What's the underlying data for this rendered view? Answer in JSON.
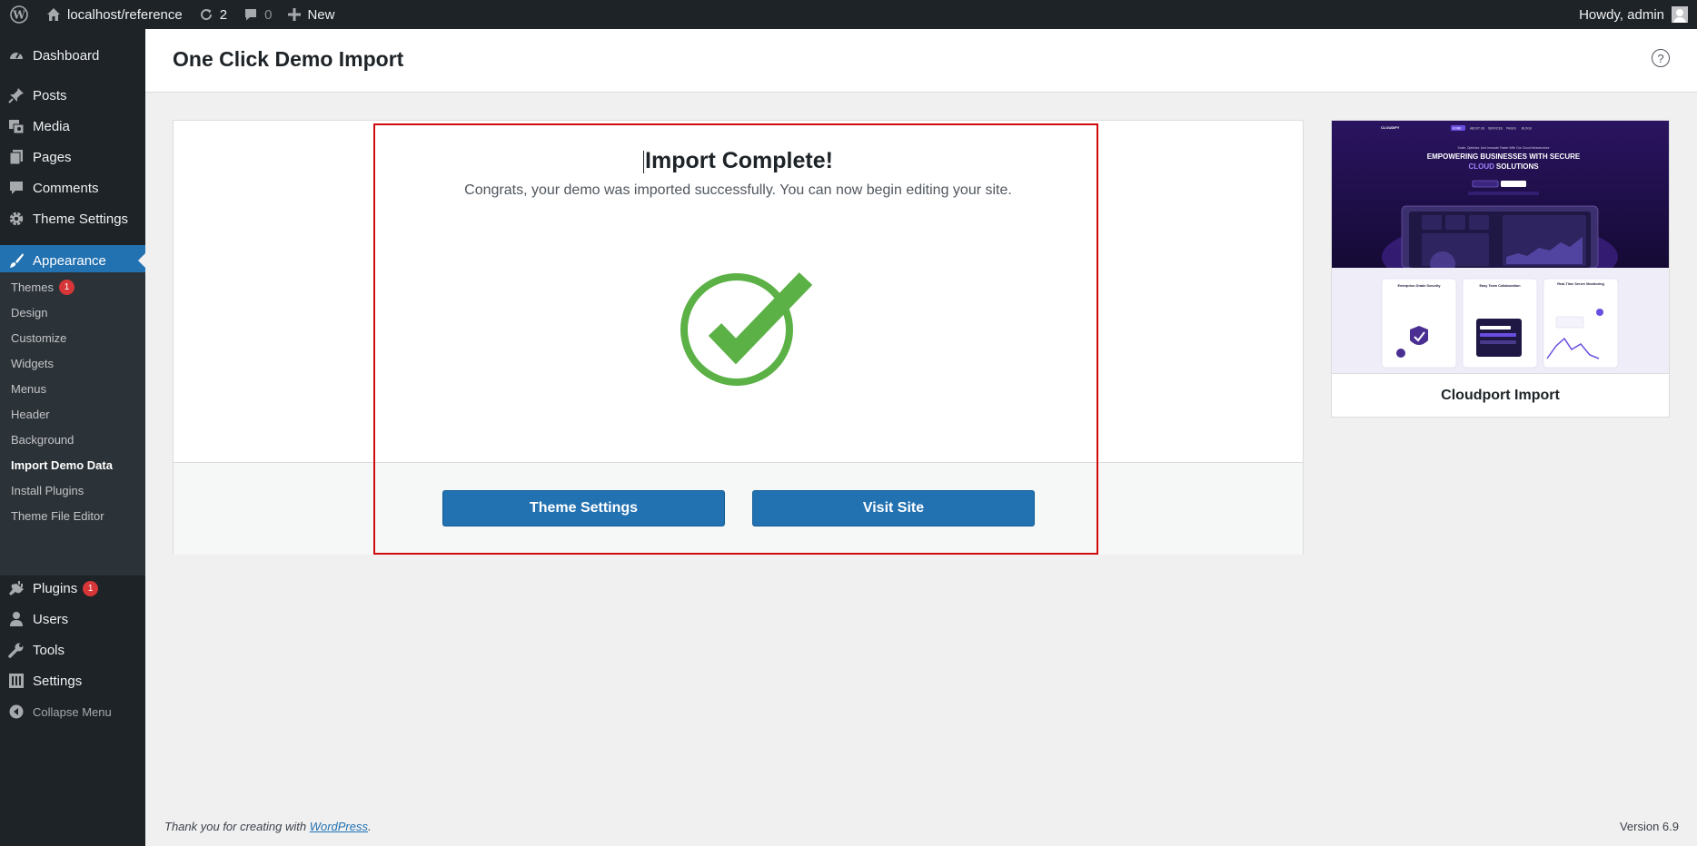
{
  "adminbar": {
    "site_name": "localhost/reference",
    "updates_count": "2",
    "comments_count": "0",
    "new_label": "New",
    "howdy": "Howdy, admin"
  },
  "sidebar": {
    "items": [
      {
        "label": "Dashboard",
        "icon": "dashboard-icon"
      },
      {
        "label": "Posts",
        "icon": "pin-icon"
      },
      {
        "label": "Media",
        "icon": "media-icon"
      },
      {
        "label": "Pages",
        "icon": "pages-icon"
      },
      {
        "label": "Comments",
        "icon": "comment-icon"
      },
      {
        "label": "Theme Settings",
        "icon": "gear-icon"
      },
      {
        "label": "Appearance",
        "icon": "paintbrush-icon"
      },
      {
        "label": "Plugins",
        "icon": "plugin-icon",
        "badge": "1"
      },
      {
        "label": "Users",
        "icon": "user-icon"
      },
      {
        "label": "Tools",
        "icon": "wrench-icon"
      },
      {
        "label": "Settings",
        "icon": "settings-icon"
      }
    ],
    "submenu": [
      {
        "label": "Themes",
        "badge": "1"
      },
      {
        "label": "Design"
      },
      {
        "label": "Customize"
      },
      {
        "label": "Widgets"
      },
      {
        "label": "Menus"
      },
      {
        "label": "Header"
      },
      {
        "label": "Background"
      },
      {
        "label": "Import Demo Data"
      },
      {
        "label": "Install Plugins"
      },
      {
        "label": "Theme File Editor"
      }
    ],
    "collapse_label": "Collapse Menu"
  },
  "page": {
    "title": "One Click Demo Import",
    "help_symbol": "?"
  },
  "import": {
    "title": "Import Complete!",
    "description": "Congrats, your demo was imported successfully. You can now begin editing your site.",
    "theme_settings_button": "Theme Settings",
    "visit_site_button": "Visit Site"
  },
  "demo": {
    "title": "Cloudport Import",
    "preview": {
      "brand": "CLOUDIFY",
      "nav": [
        "HOME",
        "ABOUT US",
        "SERVICES",
        "PAGES",
        "BLOGS"
      ],
      "tagline": "Scale, Optimize, And Innovate Faster With Our Cloud Infrastructure",
      "headline_1": "EMPOWERING BUSINESSES WITH SECURE",
      "headline_2a": "CLOUD",
      "headline_2b": "SOLUTIONS",
      "cards": [
        "Enterprise-Grade Security",
        "Easy Team Collaboration",
        "Real-Time Server Monitoring"
      ]
    }
  },
  "footer": {
    "thanks_prefix": "Thank you for creating with ",
    "wp_link": "WordPress",
    "thanks_suffix": ".",
    "version": "Version 6.9"
  },
  "colors": {
    "accent": "#2271b1",
    "check_green": "#5bb146",
    "highlight_red": "#d10b0b",
    "badge_red": "#d63638"
  }
}
